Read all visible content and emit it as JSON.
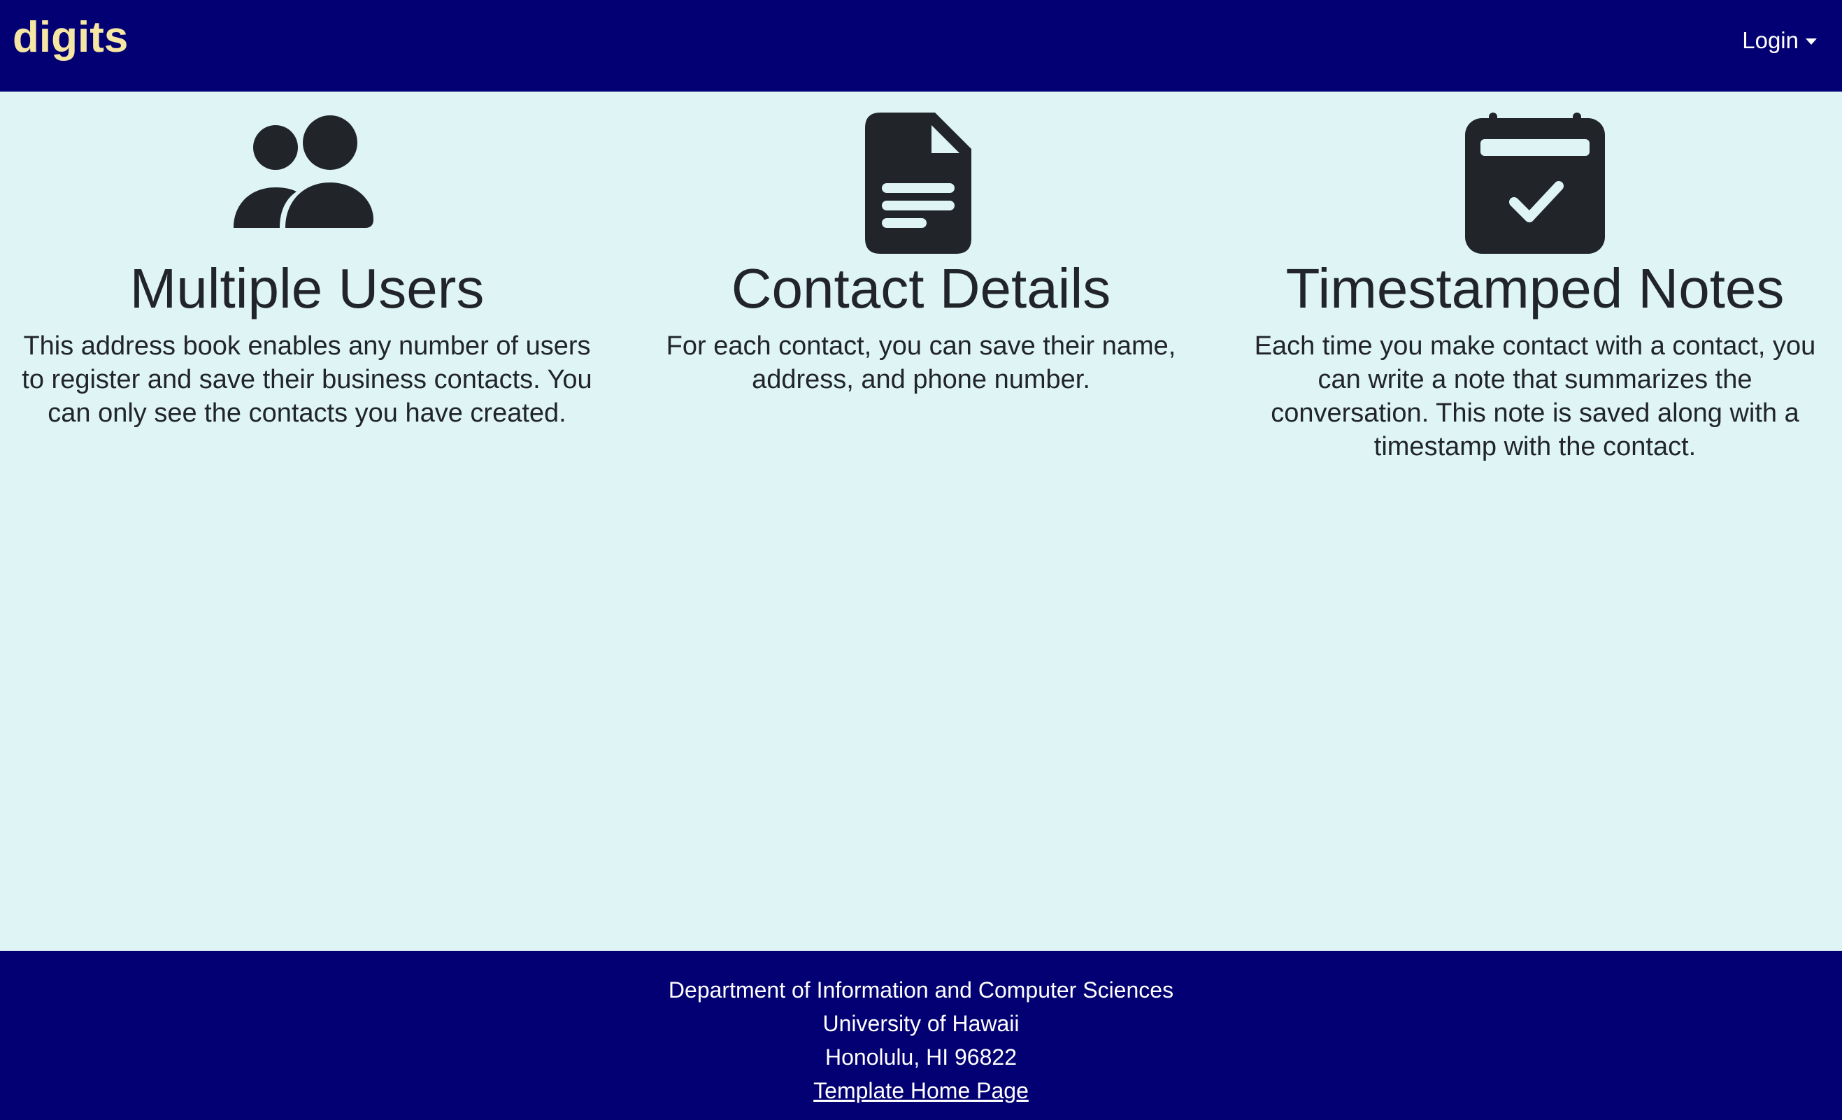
{
  "navbar": {
    "brand": "digits",
    "login_label": "Login",
    "background_color": "#020072",
    "brand_color": "#f5e6a3"
  },
  "features": [
    {
      "icon": "people-icon",
      "title": "Multiple Users",
      "description": "This address book enables any number of users to register and save their business contacts. You can only see the contacts you have created."
    },
    {
      "icon": "document-icon",
      "title": "Contact Details",
      "description": "For each contact, you can save their name, address, and phone number."
    },
    {
      "icon": "calendar-check-icon",
      "title": "Timestamped Notes",
      "description": "Each time you make contact with a contact, you can write a note that summarizes the conversation. This note is saved along with a timestamp with the contact."
    }
  ],
  "footer": {
    "line1": "Department of Information and Computer Sciences",
    "line2": "University of Hawaii",
    "line3": "Honolulu, HI 96822",
    "link_label": "Template Home Page"
  },
  "colors": {
    "page_background": "#dff5f5",
    "text": "#212529"
  }
}
